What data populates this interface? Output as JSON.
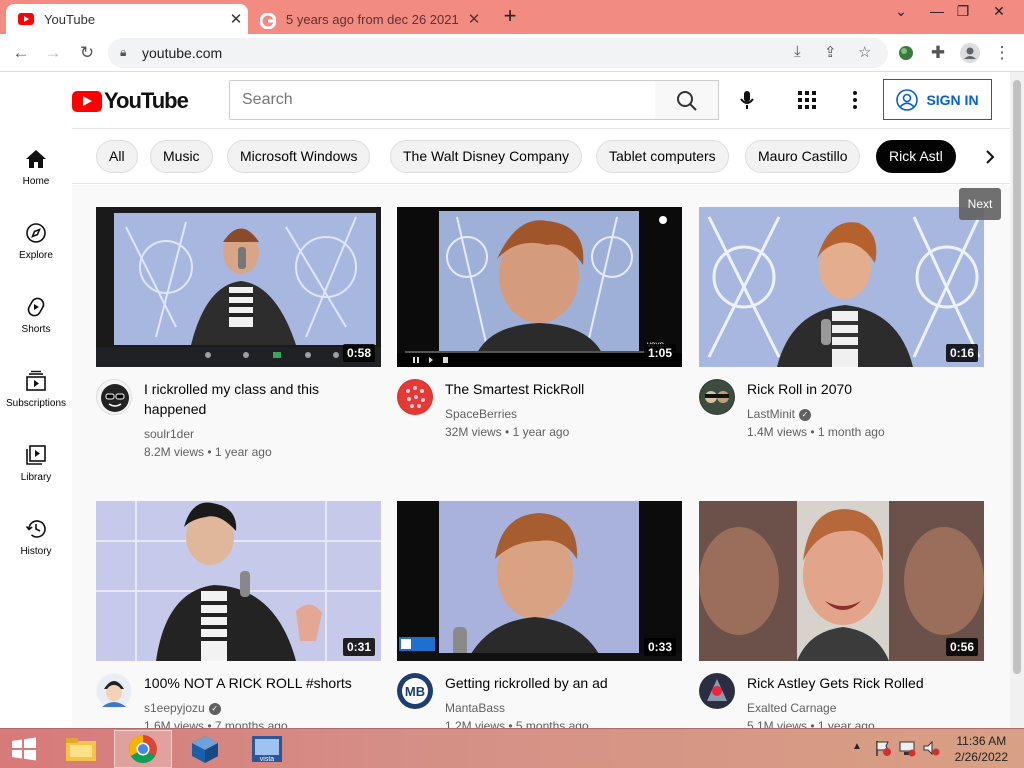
{
  "browser": {
    "tabs": [
      {
        "title": "YouTube",
        "active": true
      },
      {
        "title": "5 years ago from dec 26 2021 - G",
        "active": false
      }
    ],
    "url": "youtube.com",
    "theme_color": "#f28b82"
  },
  "youtube": {
    "search_placeholder": "Search",
    "sign_in_label": "SIGN IN",
    "nav": [
      {
        "label": "Home",
        "icon": "home-icon"
      },
      {
        "label": "Explore",
        "icon": "compass-icon"
      },
      {
        "label": "Shorts",
        "icon": "shorts-icon"
      },
      {
        "label": "Subscriptions",
        "icon": "subscriptions-icon"
      },
      {
        "label": "Library",
        "icon": "library-icon"
      },
      {
        "label": "History",
        "icon": "history-icon"
      }
    ],
    "chips": [
      "All",
      "Music",
      "Microsoft Windows",
      "The Walt Disney Company",
      "Tablet computers",
      "Mauro Castillo",
      "Rick Astl"
    ],
    "tooltip": "Next",
    "videos": [
      {
        "title": "I rickrolled my class and this happened",
        "channel": "soulr1der",
        "verified": false,
        "views": "8.2M views",
        "age": "1 year ago",
        "duration": "0:58"
      },
      {
        "title": "The Smartest RickRoll",
        "channel": "SpaceBerries",
        "verified": false,
        "views": "32M views",
        "age": "1 year ago",
        "duration": "1:05"
      },
      {
        "title": "Rick Roll in 2070",
        "channel": "LastMinit",
        "verified": true,
        "views": "1.4M views",
        "age": "1 month ago",
        "duration": "0:16"
      },
      {
        "title": "100% NOT A RICK ROLL #shorts",
        "channel": "s1eepyjozu",
        "verified": true,
        "views": "1.6M views",
        "age": "7 months ago",
        "duration": "0:31"
      },
      {
        "title": "Getting rickrolled by an ad",
        "channel": "MantaBass",
        "verified": false,
        "views": "1.2M views",
        "age": "5 months ago",
        "duration": "0:33"
      },
      {
        "title": "Rick Astley Gets Rick Rolled",
        "channel": "Exalted Carnage",
        "verified": false,
        "views": "5.1M views",
        "age": "1 year ago",
        "duration": "0:56"
      }
    ]
  },
  "taskbar": {
    "time": "11:36 AM",
    "date": "2/26/2022"
  }
}
